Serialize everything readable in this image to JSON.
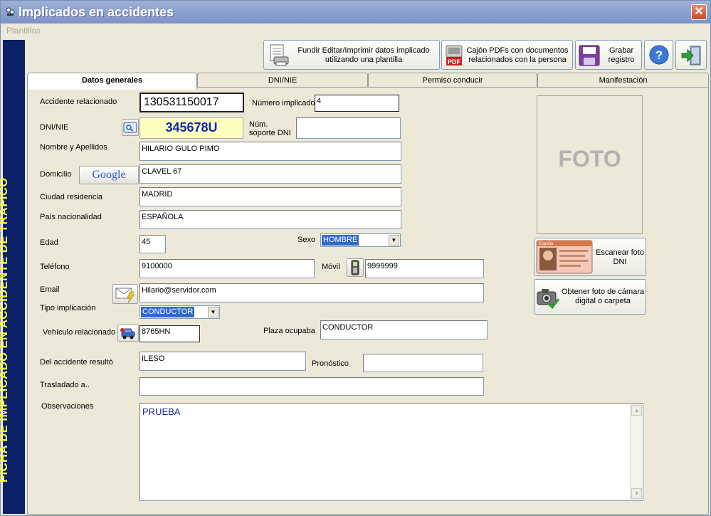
{
  "window": {
    "title": "Implicados en accidentes",
    "close_label": "✕"
  },
  "menu": {
    "plantillas": "Plantillas"
  },
  "sidebar": {
    "vertical_title": "FICHA DE IMPLICADO EN ACCIDENTE DE TRÁFICO"
  },
  "toolbar": {
    "merge_label_1": "Fundir Editar/Imprimir datos implicado",
    "merge_label_2": "utilizando una plantilla",
    "pdf_label_1": "Cajón PDFs con documentos",
    "pdf_label_2": "relacionados con la persona",
    "save_label_1": "Grabar",
    "save_label_2": "registro",
    "help_glyph": "?"
  },
  "tabs": [
    {
      "label": "Datos generales"
    },
    {
      "label": "DNI/NIE"
    },
    {
      "label": "Permiso conducir"
    },
    {
      "label": "Manifestación"
    }
  ],
  "form": {
    "accidente_label": "Accidente relacionado",
    "accidente_value": "130531150017",
    "numero_label": "Número implicado",
    "numero_value": "4",
    "dni_label": "DNI/NIE",
    "dni_value": "345678U",
    "soporte_label_1": "Núm.",
    "soporte_label_2": "soporte DNI",
    "soporte_value": "",
    "nombre_label": "Nombre y Apellidos",
    "nombre_value": "HILARIO GULO PIMO",
    "domicilio_label": "Domicilio",
    "google_label": "Google",
    "domicilio_value": "CLAVEL 67",
    "ciudad_label": "Ciudad residencia",
    "ciudad_value": "MADRID",
    "pais_label": "País nacionalidad",
    "pais_value": "ESPAÑOLA",
    "edad_label": "Edad",
    "edad_value": "45",
    "sexo_label": "Sexo",
    "sexo_value": "HOMBRE",
    "telefono_label": "Teléfono",
    "telefono_value": "9100000",
    "movil_label": "Móvil",
    "movil_value": "9999999",
    "email_label": "Email",
    "email_value": "Hilario@servidor.com",
    "tipo_label": "Tipo implicación",
    "tipo_value": "CONDUCTOR",
    "vehiculo_label": "Vehículo relacionado",
    "vehiculo_value": "8765HN",
    "plaza_label": "Plaza ocupaba",
    "plaza_value": "CONDUCTOR",
    "resulto_label": "Del accidente resultó",
    "resulto_value": "ILESO",
    "pronostico_label": "Pronóstico",
    "pronostico_value": "",
    "trasladado_label": "Trasladado a..",
    "trasladado_value": "",
    "observaciones_label": "Observaciones",
    "observaciones_value": "PRUEBA"
  },
  "photo": {
    "placeholder": "FOTO",
    "scan_label_1": "Escanear foto",
    "scan_label_2": "DNI",
    "camera_label_1": "Obtener foto de cámara",
    "camera_label_2": "digital o carpeta",
    "card_text": "España"
  },
  "colors": {
    "sidebar": "#0b2066",
    "sidebar_text": "#ffff33",
    "dni_bg": "#ffffc0",
    "dni_text": "#0d2aa8",
    "selection": "#316ac5"
  }
}
